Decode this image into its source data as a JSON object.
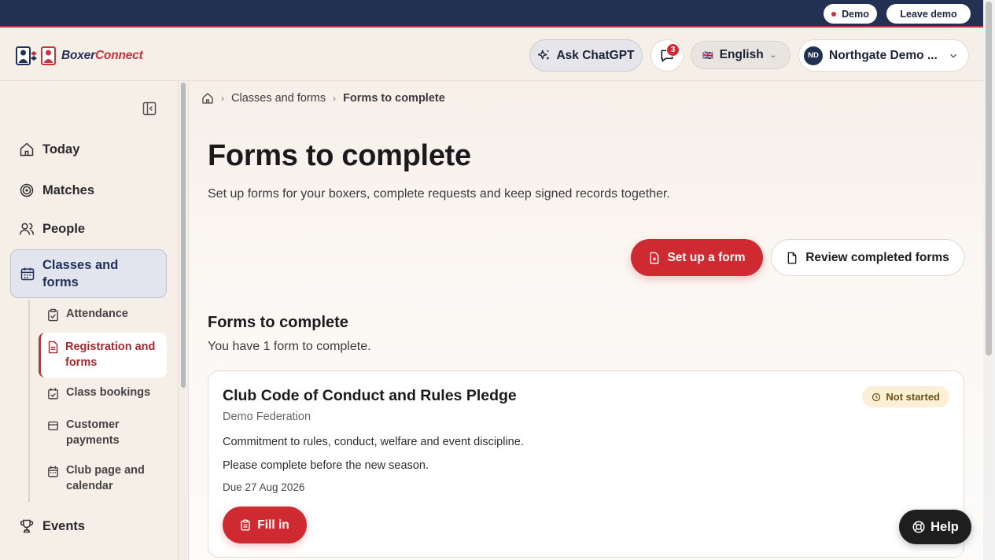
{
  "demo_bar": {
    "demo_label": "Demo",
    "leave_label": "Leave demo"
  },
  "header": {
    "brand_part1": "Boxer",
    "brand_part2": "Connect",
    "ask_label": "Ask ChatGPT",
    "messages_count": "3",
    "language": "English",
    "language_flag": "🇬🇧",
    "user_initials": "ND",
    "user_name": "Northgate Demo ..."
  },
  "sidebar": {
    "items": [
      {
        "label": "Today",
        "icon": "home-icon"
      },
      {
        "label": "Matches",
        "icon": "target-icon"
      },
      {
        "label": "People",
        "icon": "people-icon"
      },
      {
        "label": "Classes and forms",
        "icon": "calendar-icon"
      },
      {
        "label": "Events",
        "icon": "trophy-icon"
      }
    ],
    "sub_items": [
      {
        "label": "Attendance",
        "icon": "clipboard-check-icon"
      },
      {
        "label": "Registration and forms",
        "icon": "document-icon"
      },
      {
        "label": "Class bookings",
        "icon": "calendar-check-icon"
      },
      {
        "label": "Customer payments",
        "icon": "wallet-icon"
      },
      {
        "label": "Club page and calendar",
        "icon": "calendar-grid-icon"
      }
    ]
  },
  "breadcrumb": {
    "parent": "Classes and forms",
    "current": "Forms to complete"
  },
  "page": {
    "title": "Forms to complete",
    "description": "Set up forms for your boxers, complete requests and keep signed records together.",
    "primary_action": "Set up a form",
    "secondary_action": "Review completed forms"
  },
  "section": {
    "title": "Forms to complete",
    "subtitle": "You have 1 form to complete."
  },
  "forms": [
    {
      "title": "Club Code of Conduct and Rules Pledge",
      "organization": "Demo Federation",
      "description": "Commitment to rules, conduct, welfare and event discipline.",
      "note": "Please complete before the new season.",
      "due": "Due 27 Aug 2026",
      "status": "Not started",
      "action": "Fill in"
    }
  ],
  "help_label": "Help",
  "colors": {
    "navy": "#223052",
    "accent_red": "#cf2a31",
    "background": "#f7efe8"
  }
}
